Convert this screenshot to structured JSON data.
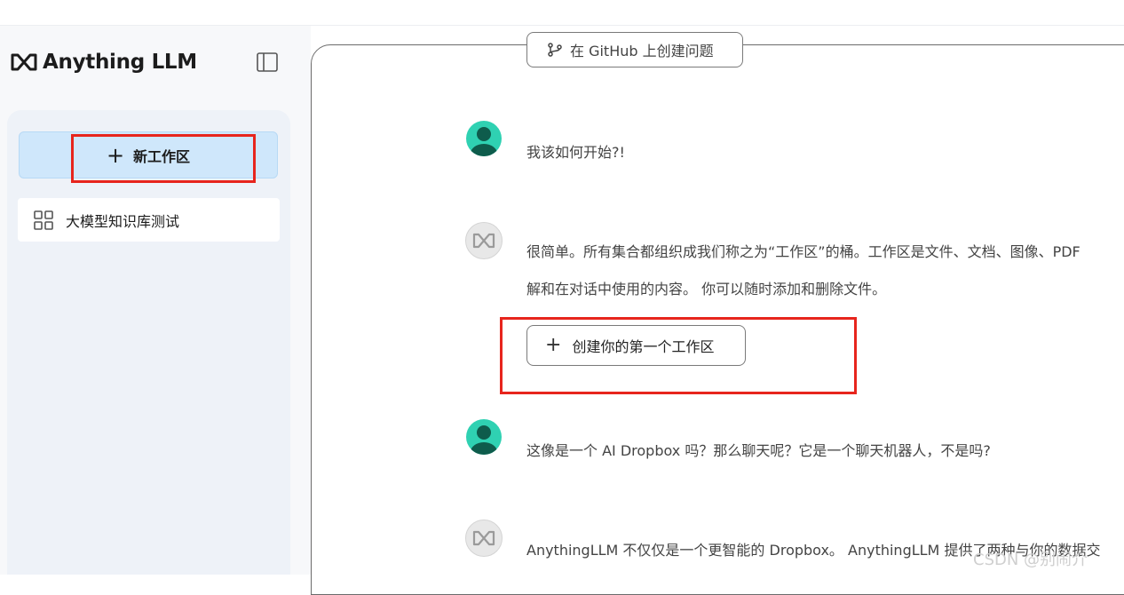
{
  "app": {
    "logo_text": "Anything LLM"
  },
  "sidebar": {
    "new_workspace_label": "新工作区",
    "workspaces": [
      {
        "name": "大模型知识库测试"
      }
    ]
  },
  "chat": {
    "github_button_label": "在 GitHub 上创建问题",
    "messages": [
      {
        "role": "user",
        "text": "我该如何开始?!"
      },
      {
        "role": "assistant",
        "lines": [
          "很简单。所有集合都组织成我们称之为“工作区”的桶。工作区是文件、文档、图像、PDF",
          "解和在对话中使用的内容。 你可以随时添加和删除文件。"
        ]
      },
      {
        "role": "user",
        "text": "这像是一个 AI Dropbox 吗？那么聊天呢？它是一个聊天机器人，不是吗?"
      },
      {
        "role": "assistant",
        "text": "AnythingLLM 不仅仅是一个更智能的 Dropbox。 AnythingLLM 提供了两种与你的数据交"
      }
    ],
    "create_workspace_button_label": "创建你的第一个工作区"
  },
  "watermark": "CSDN @别闹介",
  "colors": {
    "highlight_box": "#e7251d",
    "new_workspace_bg": "#cfe7fb",
    "user_avatar": "#2fd1b2"
  }
}
